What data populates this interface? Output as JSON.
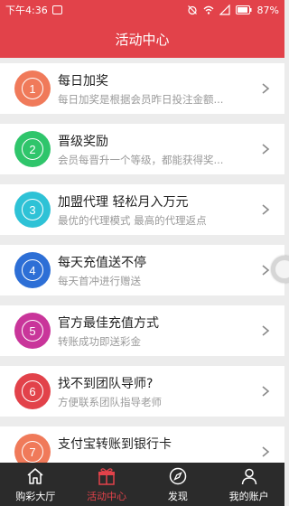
{
  "status_bar": {
    "time": "下午4:36",
    "battery": "87%"
  },
  "header": {
    "title": "活动中心"
  },
  "colors": {
    "accent": "#e2424a",
    "tabbar": "#2b2b2b"
  },
  "activities": [
    {
      "number": "1",
      "title": "每日加奖",
      "desc": "每日加奖是根据会员昨日投注金额...",
      "color": "#f07a5a",
      "icon": "circled-one-icon"
    },
    {
      "number": "2",
      "title": "晋级奖励",
      "desc": "会员每晋升一个等级，都能获得奖...",
      "color": "#2fc56b",
      "icon": "circled-two-icon"
    },
    {
      "number": "3",
      "title": "加盟代理  轻松月入万元",
      "desc": "最优的代理模式 最高的代理返点",
      "color": "#2ec2d6",
      "icon": "circled-three-icon"
    },
    {
      "number": "4",
      "title": "每天充值送不停",
      "desc": "每天首冲进行赠送",
      "color": "#2d6fd6",
      "icon": "circled-four-icon"
    },
    {
      "number": "5",
      "title": "官方最佳充值方式",
      "desc": "转账成功即送彩金",
      "color": "#c9359a",
      "icon": "circled-five-icon"
    },
    {
      "number": "6",
      "title": "找不到团队导师?",
      "desc": "方便联系团队指导老师",
      "color": "#e2424a",
      "icon": "circled-six-icon"
    },
    {
      "number": "7",
      "title": "支付宝转账到银行卡",
      "desc": "",
      "color": "#f07a5a",
      "icon": "circled-seven-icon"
    }
  ],
  "tabs": [
    {
      "label": "购彩大厅",
      "icon": "home-icon",
      "active": false
    },
    {
      "label": "活动中心",
      "icon": "gift-icon",
      "active": true
    },
    {
      "label": "发现",
      "icon": "compass-icon",
      "active": false
    },
    {
      "label": "我的账户",
      "icon": "user-icon",
      "active": false
    }
  ]
}
